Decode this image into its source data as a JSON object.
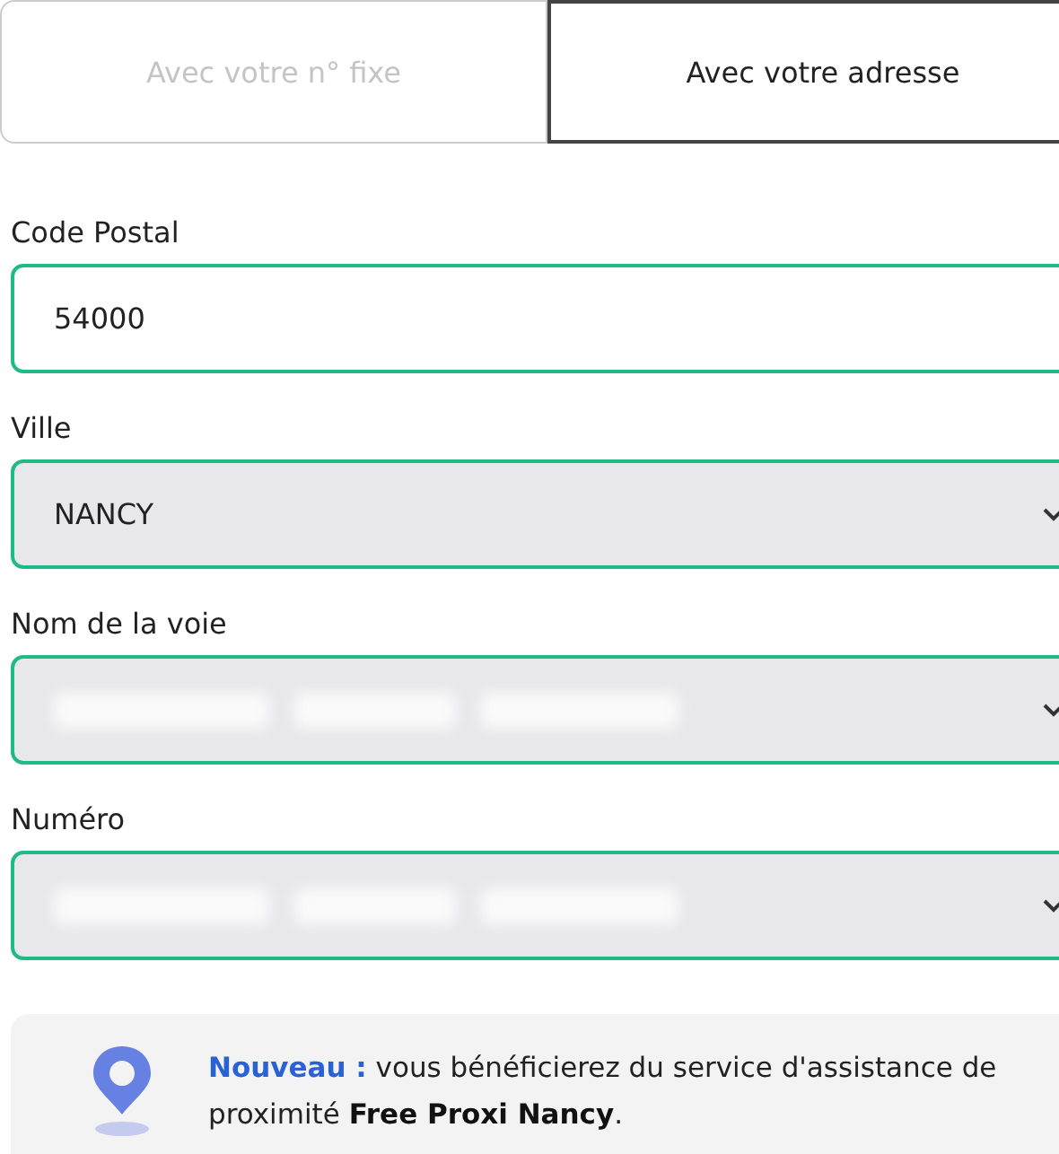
{
  "tabs": [
    {
      "label": "Avec votre n° fixe",
      "selected": false
    },
    {
      "label": "Avec votre adresse",
      "selected": true
    }
  ],
  "fields": [
    {
      "label": "Code Postal",
      "kind": "input",
      "value": "54000"
    },
    {
      "label": "Ville",
      "kind": "select",
      "value": "NANCY"
    },
    {
      "label": "Nom de la voie",
      "kind": "select",
      "value_blurred": true
    },
    {
      "label": "Numéro",
      "kind": "select",
      "value_blurred": true
    }
  ],
  "notice": {
    "text": "**Nouveau :** vous bénéficierez du service d'assistance de proximité **Free Proxi Nancy**."
  }
}
